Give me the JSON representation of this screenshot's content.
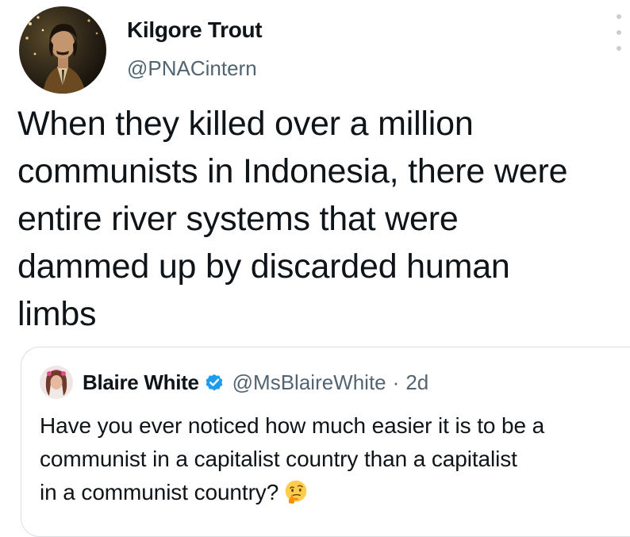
{
  "tweet": {
    "author": {
      "display_name": "Kilgore Trout",
      "handle": "@PNACintern",
      "avatar_icon": "profile-photo"
    },
    "text": "When they killed over a million\ncommunists in Indonesia, there were\nentire river systems that were\ndammed up by discarded human\nlimbs",
    "more_icon": "more-vertical-icon"
  },
  "quoted_tweet": {
    "author": {
      "display_name": "Blaire White",
      "verified": true,
      "handle": "@MsBlaireWhite",
      "avatar_icon": "profile-photo"
    },
    "separator": "·",
    "time": "2d",
    "text": "Have you ever noticed how much easier it is to be a\ncommunist in a capitalist country than a capitalist\nin a communist country?",
    "trailing_emoji": "thinking-face-emoji"
  },
  "colors": {
    "text_primary": "#0f1419",
    "text_secondary": "#536471",
    "verified_blue": "#1d9bf0",
    "border": "#dadfe3"
  }
}
